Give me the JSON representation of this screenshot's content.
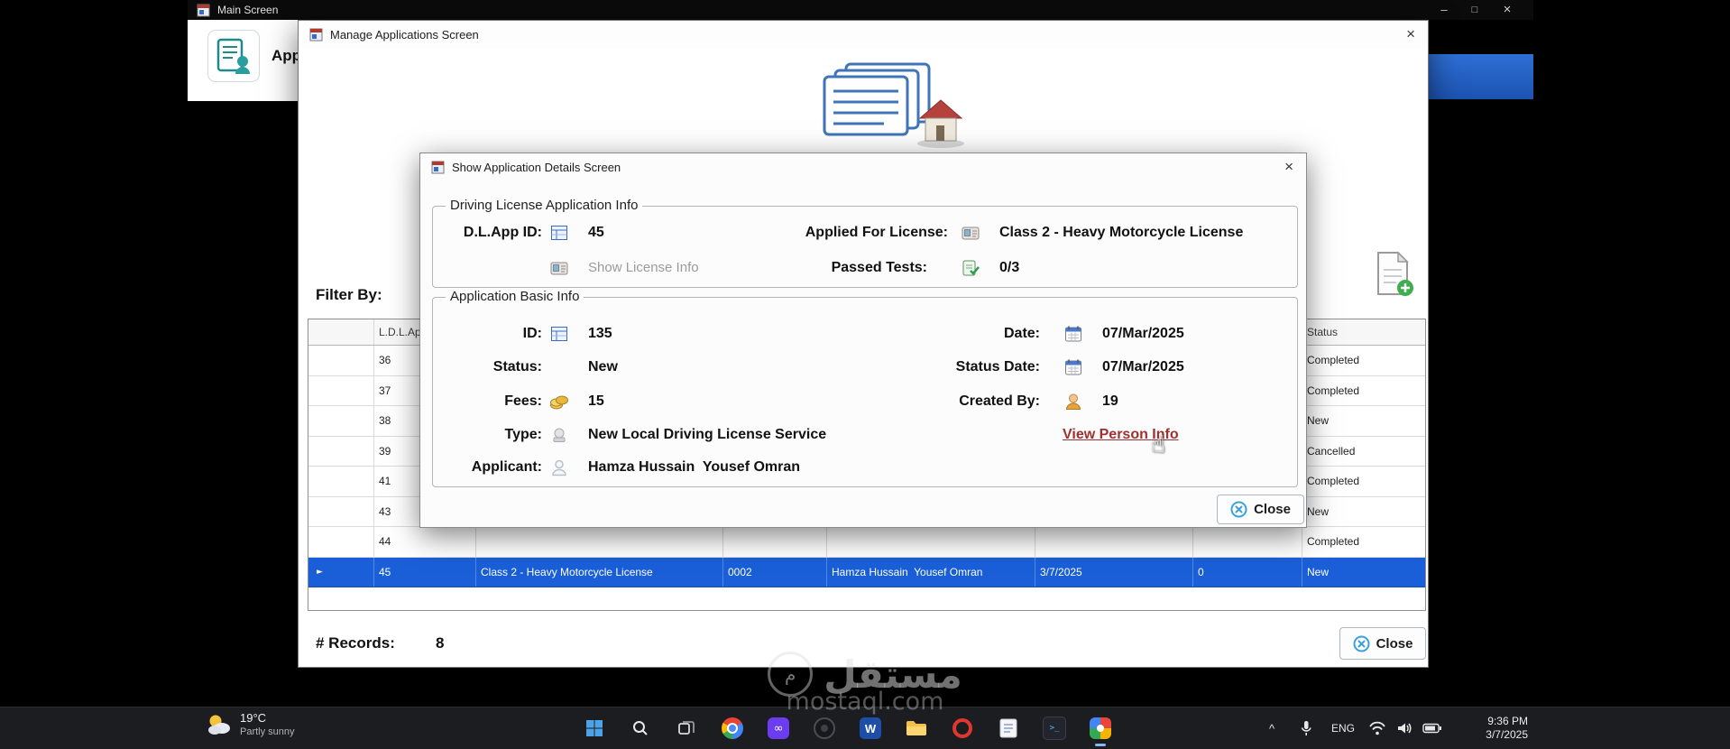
{
  "glyphs": {
    "close_x": "×",
    "minimize": "–",
    "maximize": "□",
    "chevron_up": "^",
    "row_marker": "►",
    "hand_cursor": "☝",
    "infinity": "∞",
    "word_w": "W",
    "terminal_prompt": ">_",
    "logo_letter": "م"
  },
  "main_window": {
    "title": "Main Screen",
    "header_label": "Applications"
  },
  "manage_window": {
    "title": "Manage Applications Screen",
    "filter_by_label": "Filter By:",
    "records_label": "# Records:",
    "records_value": "8",
    "close_button": "Close",
    "grid": {
      "header_id": "L.D.L.App ID",
      "header_status": "Status",
      "rows": [
        {
          "id": "36",
          "status": "Completed"
        },
        {
          "id": "37",
          "status": "Completed"
        },
        {
          "id": "38",
          "status": "New"
        },
        {
          "id": "39",
          "status": "Cancelled"
        },
        {
          "id": "41",
          "status": "Completed"
        },
        {
          "id": "43",
          "status": "New"
        },
        {
          "id": "44",
          "status": "Completed"
        }
      ],
      "selected_row": {
        "id": "45",
        "license": "Class 2 - Heavy Motorcycle License",
        "code": "0002",
        "name": "Hamza Hussain  Yousef Omran",
        "date": "3/7/2025",
        "count": "0",
        "status": "New"
      }
    }
  },
  "details_dialog": {
    "title": "Show Application Details Screen",
    "close_button": "Close",
    "license_info": {
      "group_label": "Driving License Application Info",
      "app_id_label": "D.L.App ID:",
      "app_id_value": "45",
      "applied_label": "Applied For License:",
      "applied_value": "Class 2 - Heavy Motorcycle License",
      "show_license_label": "Show License Info",
      "passed_label": "Passed Tests:",
      "passed_value": "0/3"
    },
    "basic_info": {
      "group_label": "Application Basic Info",
      "id_label": "ID:",
      "id_value": "135",
      "date_label": "Date:",
      "date_value": "07/Mar/2025",
      "status_label": "Status:",
      "status_value": "New",
      "status_date_label": "Status Date:",
      "status_date_value": "07/Mar/2025",
      "fees_label": "Fees:",
      "fees_value": "15",
      "created_by_label": "Created By:",
      "created_by_value": "19",
      "type_label": "Type:",
      "type_value": "New Local Driving License Service",
      "view_person_link": "View Person Info",
      "applicant_label": "Applicant:",
      "applicant_value": "Hamza Hussain  Yousef Omran"
    }
  },
  "taskbar": {
    "weather_temp": "19°C",
    "weather_condition": "Partly sunny",
    "language": "ENG",
    "time": "9:36 PM",
    "date": "3/7/2025",
    "icons": [
      "start",
      "search",
      "task-view",
      "chrome",
      "purple-app",
      "dark-circle-app",
      "word",
      "file-explorer",
      "red-ring-app",
      "notepad",
      "dark-terminal-app",
      "photos"
    ]
  },
  "watermark": {
    "arabic": "مستقل",
    "domain": "mostaql.com"
  }
}
